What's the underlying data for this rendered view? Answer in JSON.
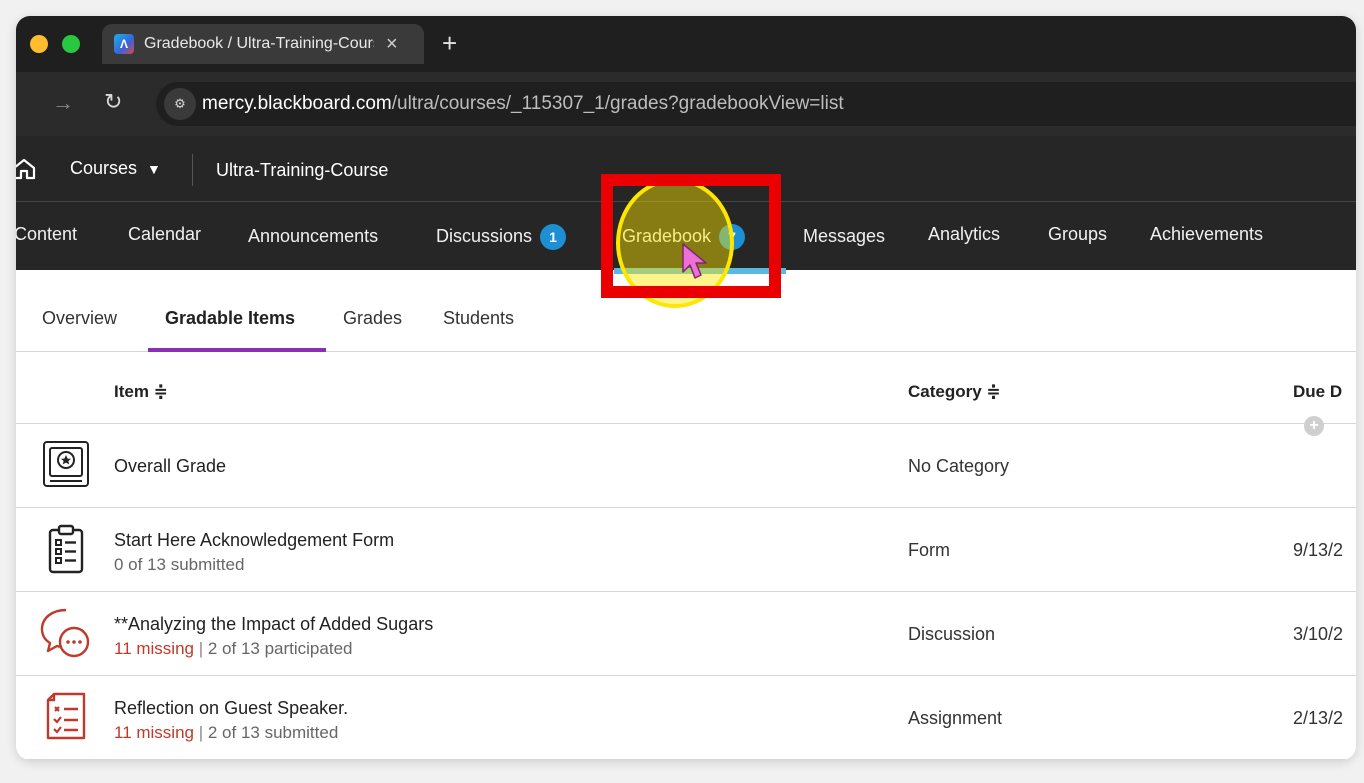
{
  "browser": {
    "tab_title": "Gradebook / Ultra-Training-Course",
    "tab_close": "×",
    "new_tab": "+",
    "url_host": "mercy.blackboard.com",
    "url_path": "/ultra/courses/_115307_1/grades?gradebookView=list",
    "favicon_letter": "Λ"
  },
  "header": {
    "courses_label": "Courses",
    "course_name": "Ultra-Training-Course"
  },
  "course_nav": {
    "items": [
      {
        "label": "Content"
      },
      {
        "label": "Calendar"
      },
      {
        "label": "Announcements"
      },
      {
        "label": "Discussions",
        "badge": "1"
      },
      {
        "label": "Gradebook",
        "badge": "7"
      },
      {
        "label": "Messages"
      },
      {
        "label": "Analytics"
      },
      {
        "label": "Groups"
      },
      {
        "label": "Achievements"
      }
    ],
    "active": "Gradebook"
  },
  "subtabs": [
    "Overview",
    "Gradable Items",
    "Grades",
    "Students"
  ],
  "table": {
    "columns": {
      "item": "Item ≑",
      "category": "Category ≑",
      "due": "Due D"
    },
    "rows": [
      {
        "icon": "overall-grade-icon",
        "title": "Overall Grade",
        "category": "No Category",
        "due": ""
      },
      {
        "icon": "form-icon",
        "title": "Start Here Acknowledgement Form",
        "status": "0 of 13 submitted",
        "category": "Form",
        "due": "9/13/2"
      },
      {
        "icon": "discussion-icon",
        "title": "**Analyzing the Impact of Added Sugars",
        "missing": "11 missing",
        "status": "2 of 13 participated",
        "category": "Discussion",
        "due": "3/10/2"
      },
      {
        "icon": "assignment-icon",
        "title": "Reflection on Guest Speaker.",
        "missing": "11 missing",
        "status": "2 of 13 submitted",
        "category": "Assignment",
        "due": "2/13/2"
      }
    ]
  },
  "colors": {
    "header_bg": "#262626",
    "badge_blue": "#1d8fd3",
    "active_tab_underline": "#8a2fb3",
    "missing_red": "#c0392b",
    "highlight_red": "#ea0000",
    "highlight_yellow": "#ffe600"
  }
}
